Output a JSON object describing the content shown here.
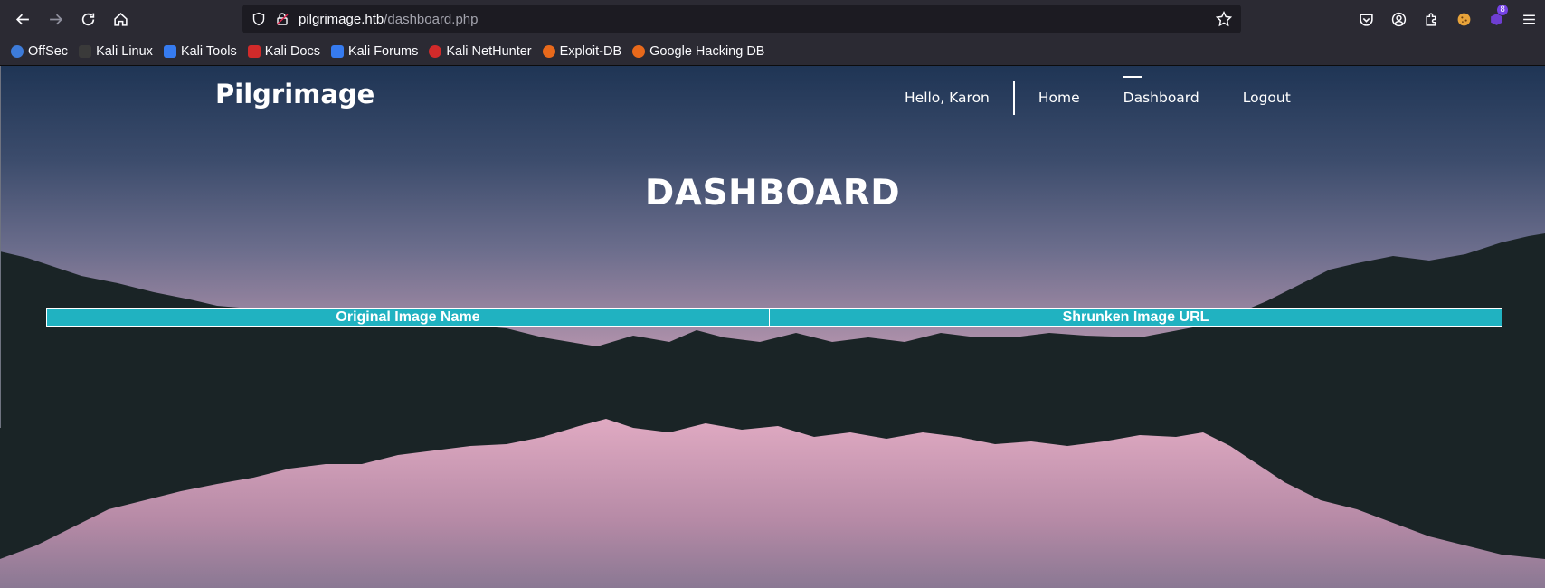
{
  "browser": {
    "url": {
      "host": "pilgrimage.htb",
      "path": "/dashboard.php"
    },
    "extension_badge": "8",
    "bookmarks": [
      {
        "label": "OffSec",
        "color": "#3d7bd9"
      },
      {
        "label": "Kali Linux",
        "color": "#2a2a2a"
      },
      {
        "label": "Kali Tools",
        "color": "#367bf0"
      },
      {
        "label": "Kali Docs",
        "color": "#d12a2a"
      },
      {
        "label": "Kali Forums",
        "color": "#367bf0"
      },
      {
        "label": "Kali NetHunter",
        "color": "#d12a2a"
      },
      {
        "label": "Exploit-DB",
        "color": "#e8691b"
      },
      {
        "label": "Google Hacking DB",
        "color": "#e8691b"
      }
    ]
  },
  "site": {
    "logo": "Pilgrimage",
    "greeting": "Hello, Karon",
    "nav": [
      "Home",
      "Dashboard",
      "Logout"
    ],
    "active_nav": "Dashboard",
    "heading": "DASHBOARD",
    "table": {
      "headers": [
        "Original Image Name",
        "Shrunken Image URL"
      ],
      "header_color": "#20b2c1",
      "rows": []
    }
  }
}
